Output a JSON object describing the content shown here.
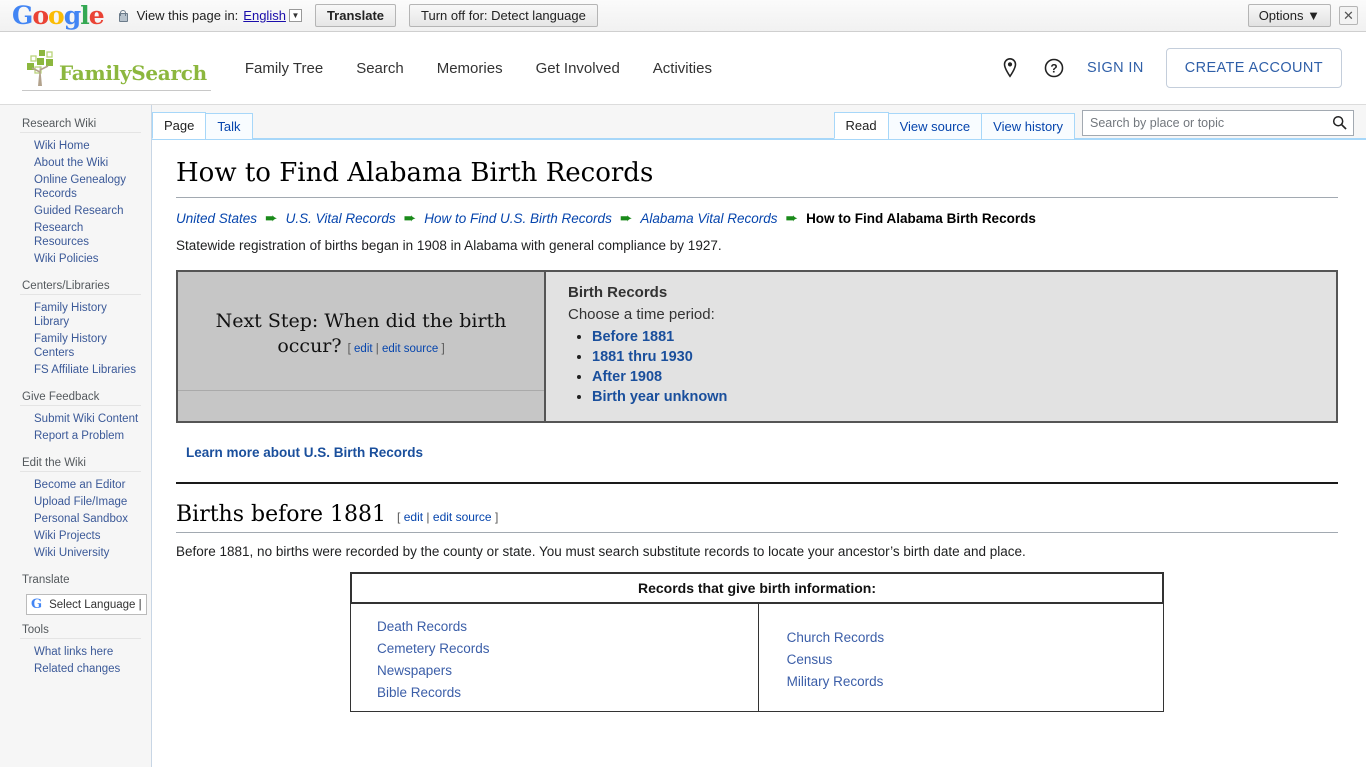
{
  "translate_bar": {
    "brand": "Google",
    "lock_icon": "lock-icon",
    "view_text": "View this page in:",
    "language": "English",
    "translate_button": "Translate",
    "turn_off_button": "Turn off for: Detect language",
    "options_button": "Options",
    "close_icon": "×"
  },
  "header": {
    "brand": "FamilySearch",
    "nav": [
      {
        "label": "Family Tree"
      },
      {
        "label": "Search"
      },
      {
        "label": "Memories"
      },
      {
        "label": "Get Involved"
      },
      {
        "label": "Activities"
      }
    ],
    "location_icon": "map-pin-icon",
    "help_icon": "question-circle-icon",
    "sign_in": "SIGN IN",
    "create_account": "CREATE ACCOUNT"
  },
  "sidebar": {
    "groups": [
      {
        "title": "Research Wiki",
        "items": [
          "Wiki Home",
          "About the Wiki",
          "Online Genealogy Records",
          "Guided Research",
          "Research Resources",
          "Wiki Policies"
        ]
      },
      {
        "title": "Centers/Libraries",
        "items": [
          "Family History Library",
          "Family History Centers",
          "FS Affiliate Libraries"
        ]
      },
      {
        "title": "Give Feedback",
        "items": [
          "Submit Wiki Content",
          "Report a Problem"
        ]
      },
      {
        "title": "Edit the Wiki",
        "items": [
          "Become an Editor",
          "Upload File/Image",
          "Personal Sandbox",
          "Wiki Projects",
          "Wiki University"
        ]
      },
      {
        "title": "Translate",
        "items": []
      },
      {
        "title": "Tools",
        "items": [
          "What links here",
          "Related changes"
        ]
      }
    ],
    "language_selector": "Select Language"
  },
  "tabs": {
    "left": [
      {
        "label": "Page",
        "selected": true
      },
      {
        "label": "Talk",
        "selected": false
      }
    ],
    "right": [
      {
        "label": "Read",
        "selected": true
      },
      {
        "label": "View source",
        "selected": false
      },
      {
        "label": "View history",
        "selected": false
      }
    ]
  },
  "search": {
    "placeholder": "Search by place or topic",
    "value": "",
    "icon": "magnifier-icon"
  },
  "main": {
    "title": "How to Find Alabama Birth Records",
    "breadcrumb": [
      "United States",
      "U.S. Vital Records",
      "How to Find U.S. Birth Records",
      "Alabama Vital Records",
      "How to Find Alabama Birth Records"
    ],
    "breadcrumb_arrow": "➨",
    "intro": "Statewide registration of births began in 1908 in Alabama with general compliance by 1927.",
    "next_step": {
      "heading": "Next Step: When did the birth occur?",
      "edit_open": "[",
      "edit": "edit",
      "edit_sep": "|",
      "edit_source": "edit source",
      "edit_close": "]"
    },
    "birth_records": {
      "title": "Birth Records",
      "subtitle": "Choose a time period:",
      "options": [
        "Before 1881",
        "1881 thru 1930",
        "After 1908",
        "Birth year unknown"
      ]
    },
    "learn_more": "Learn more about U.S. Birth Records",
    "section": {
      "title": "Births before 1881",
      "edit_open": "[",
      "edit": "edit",
      "edit_sep": "|",
      "edit_source": "edit source",
      "edit_close": "]",
      "paragraph": "Before 1881, no births were recorded by the county or state. You must search substitute records to locate your ancestor’s birth date and place."
    },
    "records_table": {
      "header": "Records that give birth information:",
      "left_column": [
        "Death Records",
        "Cemetery Records",
        "Newspapers",
        "Bible Records"
      ],
      "right_column": [
        "Church Records",
        "Census",
        "Military Records"
      ]
    }
  },
  "colors": {
    "link_blue": "#0645ad",
    "sidebar_link": "#3b5998",
    "brand_green": "#8cb73e",
    "accent_blue": "#2f5fa8",
    "arrow_green": "#1a8a1a"
  }
}
